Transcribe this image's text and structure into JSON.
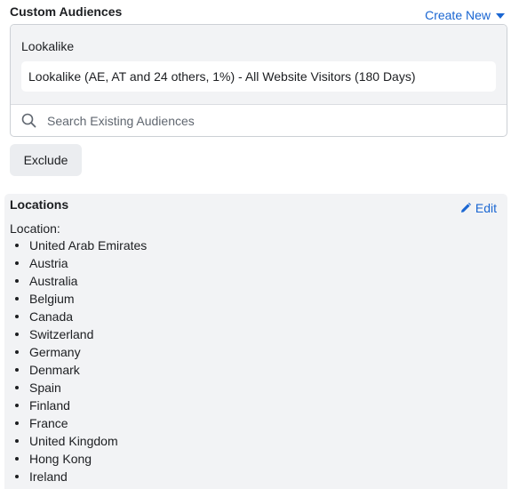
{
  "custom_audiences": {
    "title": "Custom Audiences",
    "create_new_label": "Create New",
    "group_label": "Lookalike",
    "selected_audience": "Lookalike (AE, AT and 24 others, 1%) - All Website Visitors (180 Days)",
    "search_placeholder": "Search Existing Audiences",
    "exclude_label": "Exclude"
  },
  "locations": {
    "title": "Locations",
    "edit_label": "Edit",
    "location_label": "Location:",
    "items": [
      "United Arab Emirates",
      "Austria",
      "Australia",
      "Belgium",
      "Canada",
      "Switzerland",
      "Germany",
      "Denmark",
      "Spain",
      "Finland",
      "France",
      "United Kingdom",
      "Hong Kong",
      "Ireland"
    ]
  },
  "colors": {
    "link": "#1a66d2",
    "panel_bg": "#f2f3f5",
    "border": "#ccd0d5",
    "button_bg": "#ebedf0"
  },
  "icons": {
    "search": "search-icon",
    "edit": "pencil-icon",
    "dropdown": "caret-down-icon"
  }
}
